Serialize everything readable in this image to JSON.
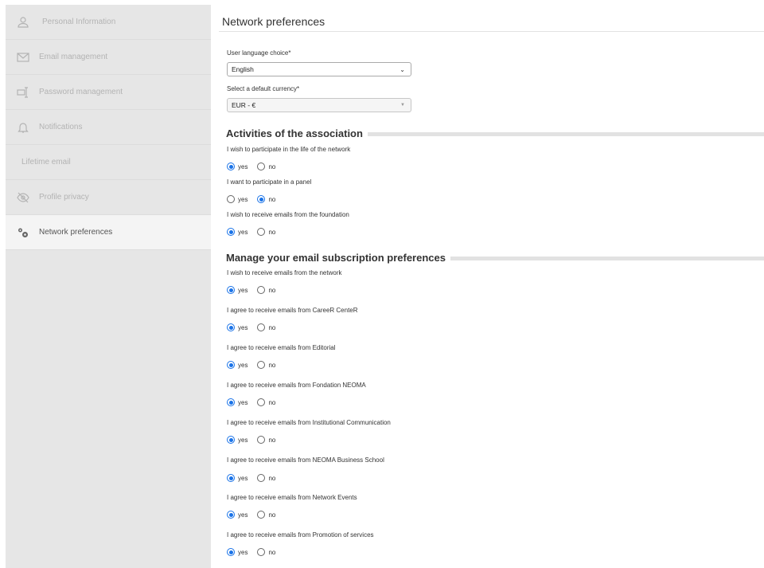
{
  "sidebar": {
    "items": [
      {
        "label": "Personal Information",
        "icon": "user-icon"
      },
      {
        "label": "Email management",
        "icon": "envelope-icon"
      },
      {
        "label": "Password management",
        "icon": "password-icon"
      },
      {
        "label": "Notifications",
        "icon": "bell-icon"
      },
      {
        "label": "Lifetime email",
        "icon": ""
      },
      {
        "label": "Profile privacy",
        "icon": "eye-slash-icon"
      },
      {
        "label": "Network preferences",
        "icon": "gears-icon",
        "active": true
      }
    ]
  },
  "main": {
    "title": "Network preferences",
    "language": {
      "label": "User language choice*",
      "value": "English"
    },
    "currency": {
      "label": "Select a default currency*",
      "value": "EUR - €"
    },
    "option_yes": "yes",
    "option_no": "no",
    "sections": [
      {
        "title": "Activities of the association",
        "questions": [
          {
            "text": "I wish to participate in the life of the network",
            "selected": "yes"
          },
          {
            "text": "I want to participate in a panel",
            "selected": "no"
          },
          {
            "text": "I wish to receive emails from the foundation",
            "selected": "yes"
          }
        ]
      },
      {
        "title": "Manage your email subscription preferences",
        "questions": [
          {
            "text": "I wish to receive emails from the network",
            "selected": "yes"
          },
          {
            "text": "I agree to receive emails from CareeR CenteR",
            "selected": "yes"
          },
          {
            "text": "I agree to receive emails from Editorial",
            "selected": "yes"
          },
          {
            "text": "I agree to receive emails from Fondation NEOMA",
            "selected": "yes"
          },
          {
            "text": "I agree to receive emails from Institutional Communication",
            "selected": "yes"
          },
          {
            "text": "I agree to receive emails from NEOMA Business School",
            "selected": "yes"
          },
          {
            "text": "I agree to receive emails from Network Events",
            "selected": "yes"
          },
          {
            "text": "I agree to receive emails from Promotion of services",
            "selected": "yes"
          }
        ]
      }
    ]
  }
}
